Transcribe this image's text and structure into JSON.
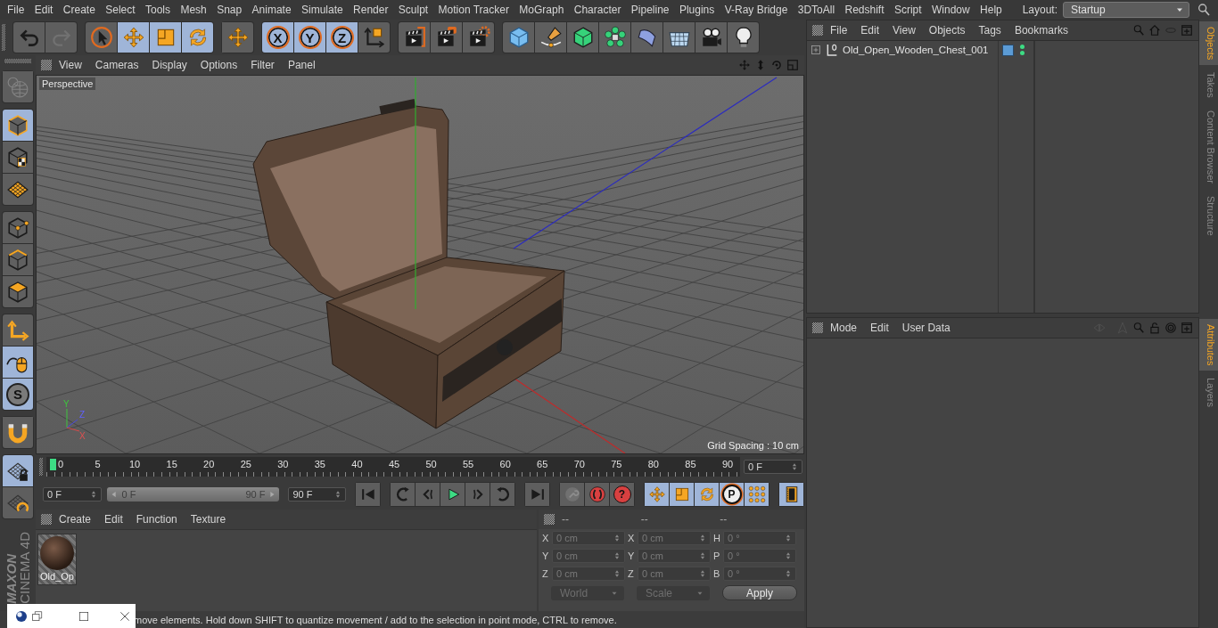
{
  "menu_bar": {
    "items": [
      "File",
      "Edit",
      "Create",
      "Select",
      "Tools",
      "Mesh",
      "Snap",
      "Animate",
      "Simulate",
      "Render",
      "Sculpt",
      "Motion Tracker",
      "MoGraph",
      "Character",
      "Pipeline",
      "Plugins",
      "V-Ray Bridge",
      "3DToAll",
      "Redshift",
      "Script",
      "Window",
      "Help"
    ],
    "layout_label": "Layout:",
    "layout_value": "Startup"
  },
  "toolbar": [
    {
      "items": [
        {
          "kind": "undo",
          "selected": false,
          "disabled": false
        },
        {
          "kind": "redo",
          "selected": false,
          "disabled": true
        }
      ]
    },
    {
      "items": [
        {
          "kind": "select",
          "selected": false,
          "disabled": false
        },
        {
          "kind": "move",
          "selected": true,
          "disabled": false
        },
        {
          "kind": "scale",
          "selected": true,
          "disabled": false
        },
        {
          "kind": "rotate",
          "selected": true,
          "disabled": false
        }
      ]
    },
    {
      "items": [
        {
          "kind": "move",
          "selected": false,
          "disabled": false
        }
      ]
    },
    {
      "items": [
        {
          "kind": "axis-lock",
          "label": "X",
          "selected": true,
          "disabled": false
        },
        {
          "kind": "axis-lock",
          "label": "Y",
          "selected": true,
          "disabled": false
        },
        {
          "kind": "axis-lock",
          "label": "Z",
          "selected": true,
          "disabled": false
        },
        {
          "kind": "coordinate-system",
          "selected": false,
          "disabled": false
        }
      ]
    },
    {
      "items": [
        {
          "kind": "clapboard-frame",
          "selected": false,
          "disabled": false
        },
        {
          "kind": "clapboard-tag",
          "selected": false,
          "disabled": false
        },
        {
          "kind": "clapboard-gear",
          "selected": false,
          "disabled": false
        }
      ]
    },
    {
      "items": [
        {
          "kind": "cube",
          "selected": false,
          "disabled": false
        },
        {
          "kind": "pen",
          "selected": false,
          "disabled": false
        },
        {
          "kind": "solid-cube",
          "selected": false,
          "disabled": false
        },
        {
          "kind": "cloner",
          "selected": false,
          "disabled": false
        },
        {
          "kind": "bend",
          "selected": false,
          "disabled": false
        },
        {
          "kind": "floor",
          "selected": false,
          "disabled": false
        },
        {
          "kind": "camera",
          "selected": false,
          "disabled": false
        },
        {
          "kind": "bulb",
          "selected": false,
          "disabled": false
        }
      ]
    }
  ],
  "side_tools": [
    {
      "items": [
        {
          "kind": "globe",
          "selected": false,
          "disabled": true
        }
      ]
    },
    {
      "items": [
        {
          "kind": "model-cube",
          "selected": true,
          "disabled": false
        },
        {
          "kind": "texture-cube",
          "selected": false,
          "disabled": false
        },
        {
          "kind": "workplane-grid",
          "selected": false,
          "disabled": false
        }
      ]
    },
    {
      "items": [
        {
          "kind": "point-cube",
          "selected": false,
          "disabled": false
        },
        {
          "kind": "edge-cube",
          "selected": false,
          "disabled": false
        },
        {
          "kind": "polygon-cube",
          "selected": false,
          "disabled": false
        }
      ]
    },
    {
      "items": [
        {
          "kind": "axis-corner",
          "selected": false,
          "disabled": false
        },
        {
          "kind": "mouse",
          "selected": true,
          "disabled": false
        },
        {
          "kind": "snap",
          "label": "S",
          "selected": true,
          "disabled": false
        }
      ]
    },
    {
      "items": [
        {
          "kind": "magnet",
          "selected": false,
          "disabled": false
        }
      ]
    },
    {
      "items": [
        {
          "kind": "grid-lock",
          "selected": true,
          "disabled": false
        },
        {
          "kind": "grid-rotate",
          "selected": false,
          "disabled": false
        }
      ]
    }
  ],
  "viewport": {
    "menu": [
      "View",
      "Cameras",
      "Display",
      "Options",
      "Filter",
      "Panel"
    ],
    "camera": "Perspective",
    "grid_spacing": "Grid Spacing : 10 cm",
    "axis_labels": [
      "Y",
      "Z",
      "X"
    ]
  },
  "timeline": {
    "frames": [
      "0",
      "5",
      "10",
      "15",
      "20",
      "25",
      "30",
      "35",
      "40",
      "45",
      "50",
      "55",
      "60",
      "65",
      "70",
      "75",
      "80",
      "85",
      "90"
    ],
    "playhead": {
      "level": 0
    },
    "frame_field": "0 F"
  },
  "transport": {
    "start_field": "0 F",
    "range_slider": {
      "start": "0 F",
      "end": "90 F",
      "level": 1
    },
    "end_field": "90 F",
    "groups": [
      {
        "items": [
          {
            "kind": "first-frame",
            "selected": false,
            "disabled": false
          }
        ]
      },
      {
        "items": [
          {
            "kind": "prev-key",
            "selected": false,
            "disabled": false
          },
          {
            "kind": "prev-frame",
            "selected": false,
            "disabled": false
          },
          {
            "kind": "play",
            "selected": false,
            "disabled": false
          },
          {
            "kind": "next-frame",
            "selected": false,
            "disabled": false
          },
          {
            "kind": "next-key",
            "selected": false,
            "disabled": false
          }
        ]
      },
      {
        "items": [
          {
            "kind": "last-frame",
            "selected": false,
            "disabled": false
          }
        ]
      },
      {
        "items": [
          {
            "kind": "key",
            "selected": false,
            "disabled": true
          },
          {
            "kind": "autokey",
            "selected": false,
            "disabled": false
          },
          {
            "kind": "help",
            "label": "?",
            "selected": false,
            "disabled": false
          }
        ]
      },
      {
        "items": [
          {
            "kind": "move",
            "selected": true,
            "disabled": false
          },
          {
            "kind": "scale",
            "selected": true,
            "disabled": false
          },
          {
            "kind": "rotate",
            "selected": true,
            "disabled": false
          },
          {
            "kind": "parameter",
            "label": "P",
            "selected": true,
            "disabled": false
          },
          {
            "kind": "dot-grid",
            "selected": true,
            "disabled": false
          }
        ]
      },
      {
        "items": [
          {
            "kind": "film",
            "selected": true,
            "disabled": false
          }
        ]
      }
    ]
  },
  "material_panel": {
    "menu": [
      "Create",
      "Edit",
      "Function",
      "Texture"
    ],
    "materials": [
      {
        "name": "Old_Op"
      }
    ]
  },
  "coordinates": {
    "headers": [
      "--",
      "--",
      "--"
    ],
    "rows": [
      {
        "pos_axis": "X",
        "pos": "0 cm",
        "size_axis": "X",
        "size": "0 cm",
        "rot_axis": "H",
        "rot": "0 °"
      },
      {
        "pos_axis": "Y",
        "pos": "0 cm",
        "size_axis": "Y",
        "size": "0 cm",
        "rot_axis": "P",
        "rot": "0 °"
      },
      {
        "pos_axis": "Z",
        "pos": "0 cm",
        "size_axis": "Z",
        "size": "0 cm",
        "rot_axis": "B",
        "rot": "0 °"
      }
    ],
    "space": "World",
    "mode": "Scale",
    "apply": "Apply"
  },
  "status_bar": "move elements. Hold down SHIFT to quantize movement / add to the selection in point mode, CTRL to remove.",
  "logo": {
    "brand": "MAXON",
    "product": "CINEMA 4D"
  },
  "objects_panel": {
    "menu": [
      "File",
      "Edit",
      "View",
      "Objects",
      "Tags",
      "Bookmarks"
    ],
    "objects": [
      {
        "name": "Old_Open_Wooden_Chest_001",
        "expanded": false,
        "visible_editor": true,
        "visible_render": true
      }
    ]
  },
  "attributes_panel": {
    "menu": [
      "Mode",
      "Edit",
      "User Data"
    ]
  },
  "side_tabs_top": [
    {
      "label": "Objects",
      "selected": true
    },
    {
      "label": "Takes",
      "selected": false
    },
    {
      "label": "Content Browser",
      "selected": false
    },
    {
      "label": "Structure",
      "selected": false
    }
  ],
  "side_tabs_bottom": [
    {
      "label": "Attributes",
      "selected": true
    },
    {
      "label": "Layers",
      "selected": false
    }
  ]
}
